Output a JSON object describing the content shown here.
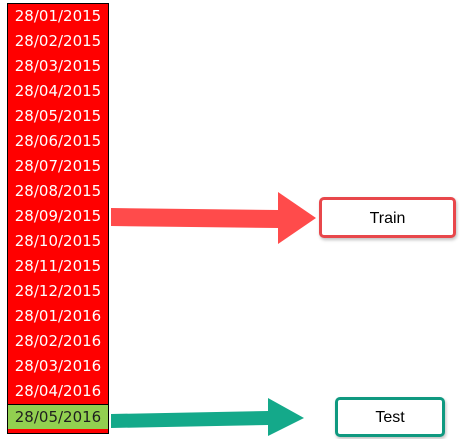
{
  "dates": [
    "28/01/2015",
    "28/02/2015",
    "28/03/2015",
    "28/04/2015",
    "28/05/2015",
    "28/06/2015",
    "28/07/2015",
    "28/08/2015",
    "28/09/2015",
    "28/10/2015",
    "28/11/2015",
    "28/12/2015",
    "28/01/2016",
    "28/02/2016",
    "28/03/2016",
    "28/04/2016",
    "28/05/2016"
  ],
  "test_index": 16,
  "labels": {
    "train": "Train",
    "test": "Test"
  },
  "colors": {
    "train_cells": "#ff0000",
    "test_cell": "#92d050",
    "train_arrow": "#ff4b4b",
    "test_arrow": "#14a98a"
  }
}
